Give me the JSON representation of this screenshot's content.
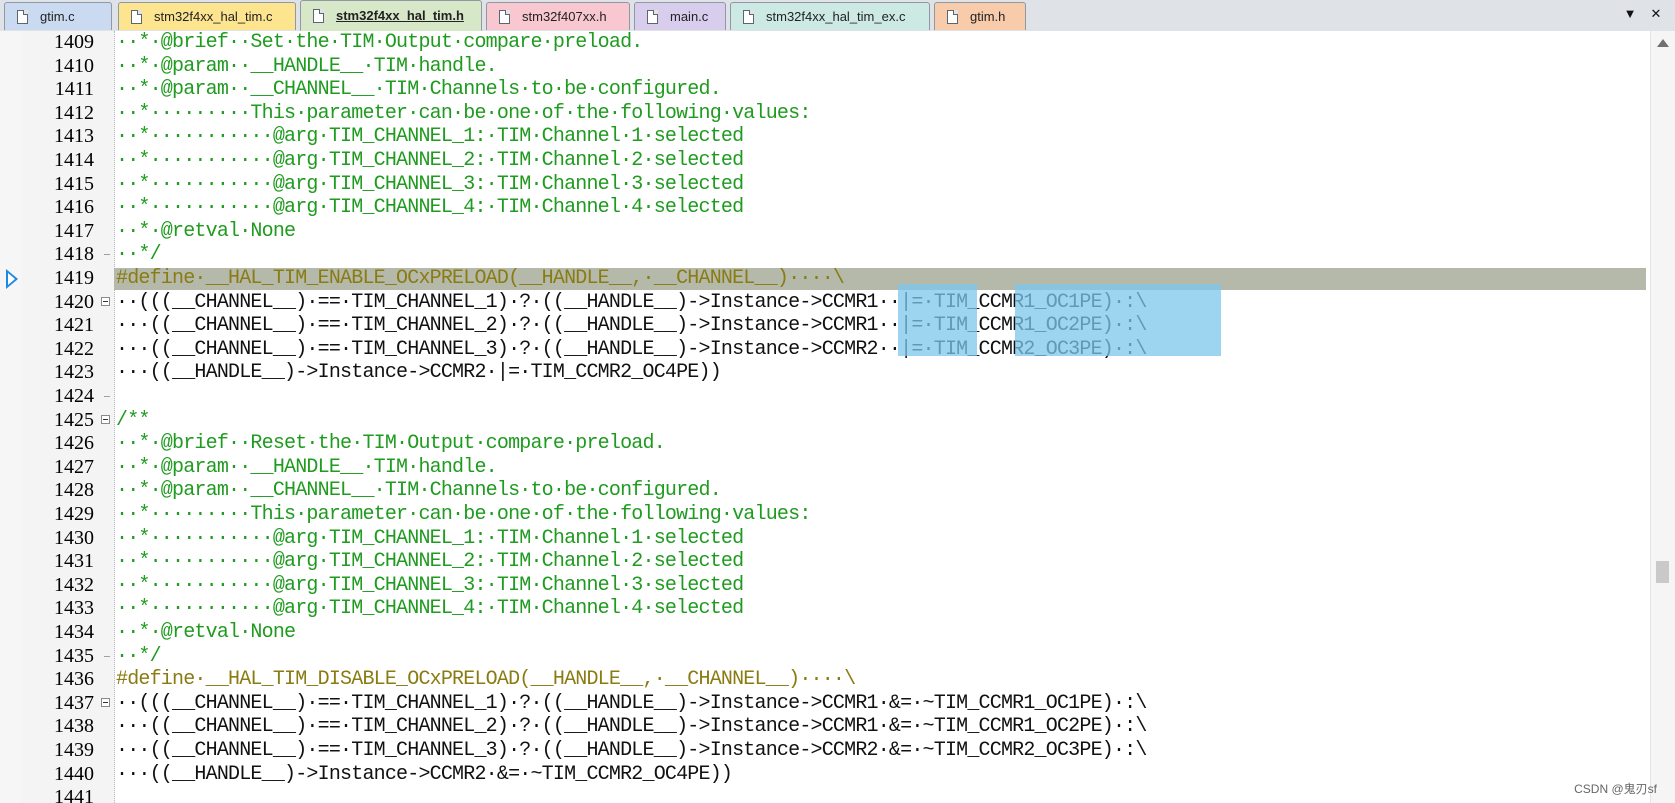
{
  "tabs": [
    {
      "label": "gtim.c",
      "color": "#c9daf1",
      "active": false
    },
    {
      "label": "stm32f4xx_hal_tim.c",
      "color": "#fde48f",
      "active": false
    },
    {
      "label": "stm32f4xx_hal_tim.h",
      "color": "#d7e8c9",
      "active": true
    },
    {
      "label": "stm32f407xx.h",
      "color": "#f8c7cf",
      "active": false
    },
    {
      "label": "main.c",
      "color": "#d9cdee",
      "active": false
    },
    {
      "label": "stm32f4xx_hal_tim_ex.c",
      "color": "#cde9e4",
      "active": false
    },
    {
      "label": "gtim.h",
      "color": "#f8ccaa",
      "active": false
    }
  ],
  "tab_controls": {
    "dropdown": "▼",
    "close": "✕"
  },
  "editor": {
    "current_line": "1419",
    "selection_color": "#7cc7ec",
    "lines": [
      {
        "n": "1409",
        "kind": "comment",
        "text": "··*·@brief··Set·the·TIM·Output·compare·preload."
      },
      {
        "n": "1410",
        "kind": "comment",
        "text": "··*·@param··__HANDLE__·TIM·handle."
      },
      {
        "n": "1411",
        "kind": "comment",
        "text": "··*·@param··__CHANNEL__·TIM·Channels·to·be·configured."
      },
      {
        "n": "1412",
        "kind": "comment",
        "text": "··*·········This·parameter·can·be·one·of·the·following·values:"
      },
      {
        "n": "1413",
        "kind": "comment",
        "text": "··*···········@arg·TIM_CHANNEL_1:·TIM·Channel·1·selected"
      },
      {
        "n": "1414",
        "kind": "comment",
        "text": "··*···········@arg·TIM_CHANNEL_2:·TIM·Channel·2·selected"
      },
      {
        "n": "1415",
        "kind": "comment",
        "text": "··*···········@arg·TIM_CHANNEL_3:·TIM·Channel·3·selected"
      },
      {
        "n": "1416",
        "kind": "comment",
        "text": "··*···········@arg·TIM_CHANNEL_4:·TIM·Channel·4·selected"
      },
      {
        "n": "1417",
        "kind": "comment",
        "text": "··*·@retval·None"
      },
      {
        "n": "1418",
        "kind": "comment",
        "text": "··*/"
      },
      {
        "n": "1419",
        "kind": "preproc",
        "text": "#define·__HAL_TIM_ENABLE_OCxPRELOAD(__HANDLE__,·__CHANNEL__)····\\"
      },
      {
        "n": "1420",
        "kind": "plain",
        "text": "··(((__CHANNEL__)·==·TIM_CHANNEL_1)·?·((__HANDLE__)->Instance->CCMR1··|=·TIM_CCMR1_OC1PE)·:\\"
      },
      {
        "n": "1421",
        "kind": "plain",
        "text": "···((__CHANNEL__)·==·TIM_CHANNEL_2)·?·((__HANDLE__)->Instance->CCMR1··|=·TIM_CCMR1_OC2PE)·:\\"
      },
      {
        "n": "1422",
        "kind": "plain",
        "text": "···((__CHANNEL__)·==·TIM_CHANNEL_3)·?·((__HANDLE__)->Instance->CCMR2··|=·TIM_CCMR2_OC3PE)·:\\"
      },
      {
        "n": "1423",
        "kind": "plain",
        "text": "···((__HANDLE__)->Instance->CCMR2·|=·TIM_CCMR2_OC4PE))"
      },
      {
        "n": "1424",
        "kind": "plain",
        "text": ""
      },
      {
        "n": "1425",
        "kind": "comment",
        "text": "/**"
      },
      {
        "n": "1426",
        "kind": "comment",
        "text": "··*·@brief··Reset·the·TIM·Output·compare·preload."
      },
      {
        "n": "1427",
        "kind": "comment",
        "text": "··*·@param··__HANDLE__·TIM·handle."
      },
      {
        "n": "1428",
        "kind": "comment",
        "text": "··*·@param··__CHANNEL__·TIM·Channels·to·be·configured."
      },
      {
        "n": "1429",
        "kind": "comment",
        "text": "··*·········This·parameter·can·be·one·of·the·following·values:"
      },
      {
        "n": "1430",
        "kind": "comment",
        "text": "··*···········@arg·TIM_CHANNEL_1:·TIM·Channel·1·selected"
      },
      {
        "n": "1431",
        "kind": "comment",
        "text": "··*···········@arg·TIM_CHANNEL_2:·TIM·Channel·2·selected"
      },
      {
        "n": "1432",
        "kind": "comment",
        "text": "··*···········@arg·TIM_CHANNEL_3:·TIM·Channel·3·selected"
      },
      {
        "n": "1433",
        "kind": "comment",
        "text": "··*···········@arg·TIM_CHANNEL_4:·TIM·Channel·4·selected"
      },
      {
        "n": "1434",
        "kind": "comment",
        "text": "··*·@retval·None"
      },
      {
        "n": "1435",
        "kind": "comment",
        "text": "··*/"
      },
      {
        "n": "1436",
        "kind": "preproc",
        "text": "#define·__HAL_TIM_DISABLE_OCxPRELOAD(__HANDLE__,·__CHANNEL__)····\\"
      },
      {
        "n": "1437",
        "kind": "plain",
        "text": "··(((__CHANNEL__)·==·TIM_CHANNEL_1)·?·((__HANDLE__)->Instance->CCMR1·&=·~TIM_CCMR1_OC1PE)·:\\"
      },
      {
        "n": "1438",
        "kind": "plain",
        "text": "···((__CHANNEL__)·==·TIM_CHANNEL_2)·?·((__HANDLE__)->Instance->CCMR1·&=·~TIM_CCMR1_OC2PE)·:\\"
      },
      {
        "n": "1439",
        "kind": "plain",
        "text": "···((__CHANNEL__)·==·TIM_CHANNEL_3)·?·((__HANDLE__)->Instance->CCMR2·&=·~TIM_CCMR2_OC3PE)·:\\"
      },
      {
        "n": "1440",
        "kind": "plain",
        "text": "···((__HANDLE__)->Instance->CCMR2·&=·~TIM_CCMR2_OC4PE))"
      },
      {
        "n": "1441",
        "kind": "plain",
        "text": ""
      }
    ]
  },
  "watermark": "CSDN @鬼刃sf"
}
